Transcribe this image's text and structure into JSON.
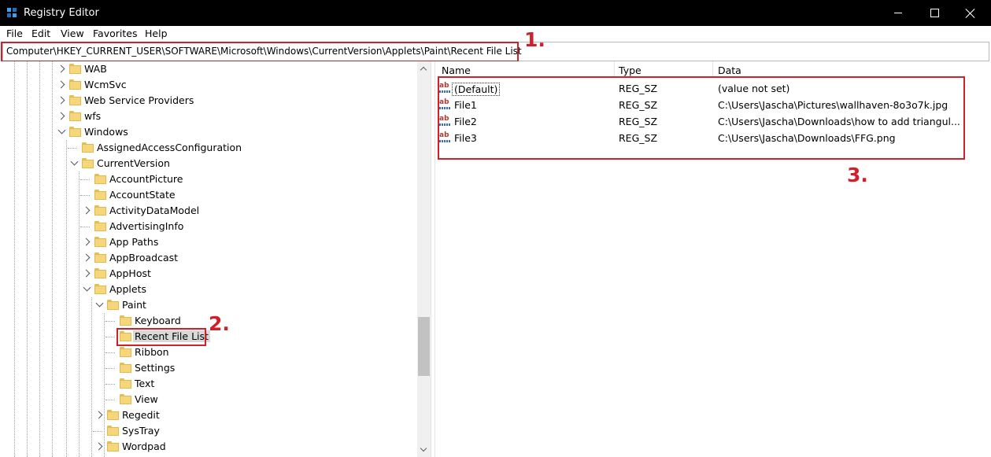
{
  "window": {
    "title": "Registry Editor",
    "controls": {
      "minimize": "minimize-icon",
      "maximize": "maximize-icon",
      "close": "close-icon"
    }
  },
  "menu": [
    "File",
    "Edit",
    "View",
    "Favorites",
    "Help"
  ],
  "address": {
    "path": "Computer\\HKEY_CURRENT_USER\\SOFTWARE\\Microsoft\\Windows\\CurrentVersion\\Applets\\Paint\\Recent File List"
  },
  "annotations": [
    "1.",
    "2.",
    "3."
  ],
  "tree": {
    "nodes": [
      {
        "label": "WAB",
        "expander": "collapsed"
      },
      {
        "label": "WcmSvc",
        "expander": "collapsed"
      },
      {
        "label": "Web Service Providers",
        "expander": "collapsed"
      },
      {
        "label": "wfs",
        "expander": "collapsed"
      },
      {
        "label": "Windows",
        "expander": "expanded"
      },
      {
        "label": "AssignedAccessConfiguration",
        "expander": "none"
      },
      {
        "label": "CurrentVersion",
        "expander": "expanded"
      },
      {
        "label": "AccountPicture",
        "expander": "none"
      },
      {
        "label": "AccountState",
        "expander": "none"
      },
      {
        "label": "ActivityDataModel",
        "expander": "collapsed"
      },
      {
        "label": "AdvertisingInfo",
        "expander": "none"
      },
      {
        "label": "App Paths",
        "expander": "collapsed"
      },
      {
        "label": "AppBroadcast",
        "expander": "collapsed"
      },
      {
        "label": "AppHost",
        "expander": "collapsed"
      },
      {
        "label": "Applets",
        "expander": "expanded"
      },
      {
        "label": "Paint",
        "expander": "expanded"
      },
      {
        "label": "Keyboard",
        "expander": "none"
      },
      {
        "label": "Recent File List",
        "expander": "none",
        "selected": true
      },
      {
        "label": "Ribbon",
        "expander": "none"
      },
      {
        "label": "Settings",
        "expander": "none"
      },
      {
        "label": "Text",
        "expander": "none"
      },
      {
        "label": "View",
        "expander": "none"
      },
      {
        "label": "Regedit",
        "expander": "collapsed"
      },
      {
        "label": "SysTray",
        "expander": "none"
      },
      {
        "label": "Wordpad",
        "expander": "collapsed"
      }
    ]
  },
  "list": {
    "columns": [
      "Name",
      "Type",
      "Data"
    ],
    "rows": [
      {
        "name": "(Default)",
        "type": "REG_SZ",
        "data": "(value not set)"
      },
      {
        "name": "File1",
        "type": "REG_SZ",
        "data": "C:\\Users\\Jascha\\Pictures\\wallhaven-8o3o7k.jpg"
      },
      {
        "name": "File2",
        "type": "REG_SZ",
        "data": "C:\\Users\\Jascha\\Downloads\\how to add triangul..."
      },
      {
        "name": "File3",
        "type": "REG_SZ",
        "data": "C:\\Users\\Jascha\\Downloads\\FFG.png"
      }
    ],
    "value_icon": "ab-string-value-icon"
  },
  "colors": {
    "annotation_red": "#d0202a",
    "folder": "#f6d67a",
    "selection": "#d9d9d9"
  }
}
